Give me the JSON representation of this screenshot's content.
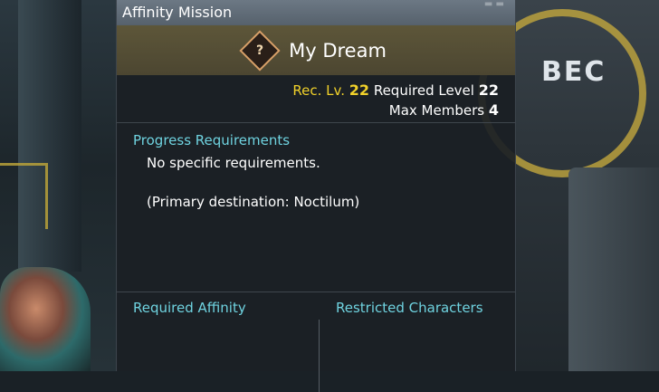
{
  "window": {
    "title": "Affinity Mission"
  },
  "mission": {
    "name": "My Dream",
    "icon": "question-mark-diamond-icon",
    "icon_glyph": "?"
  },
  "levels": {
    "rec_label": "Rec. Lv.",
    "rec_value": "22",
    "required_label": "Required Level",
    "required_value": "22",
    "members_label": "Max Members",
    "members_value": "4"
  },
  "progress": {
    "title": "Progress Requirements",
    "line1": "No specific requirements.",
    "line2": "(Primary destination: Noctilum)"
  },
  "bottom": {
    "affinity_title": "Required Affinity",
    "restricted_title": "Restricted Characters"
  },
  "colors": {
    "accent_cyan": "#6fd3e0",
    "rec_yellow": "#f1d12a",
    "banner": "#5d5639"
  }
}
